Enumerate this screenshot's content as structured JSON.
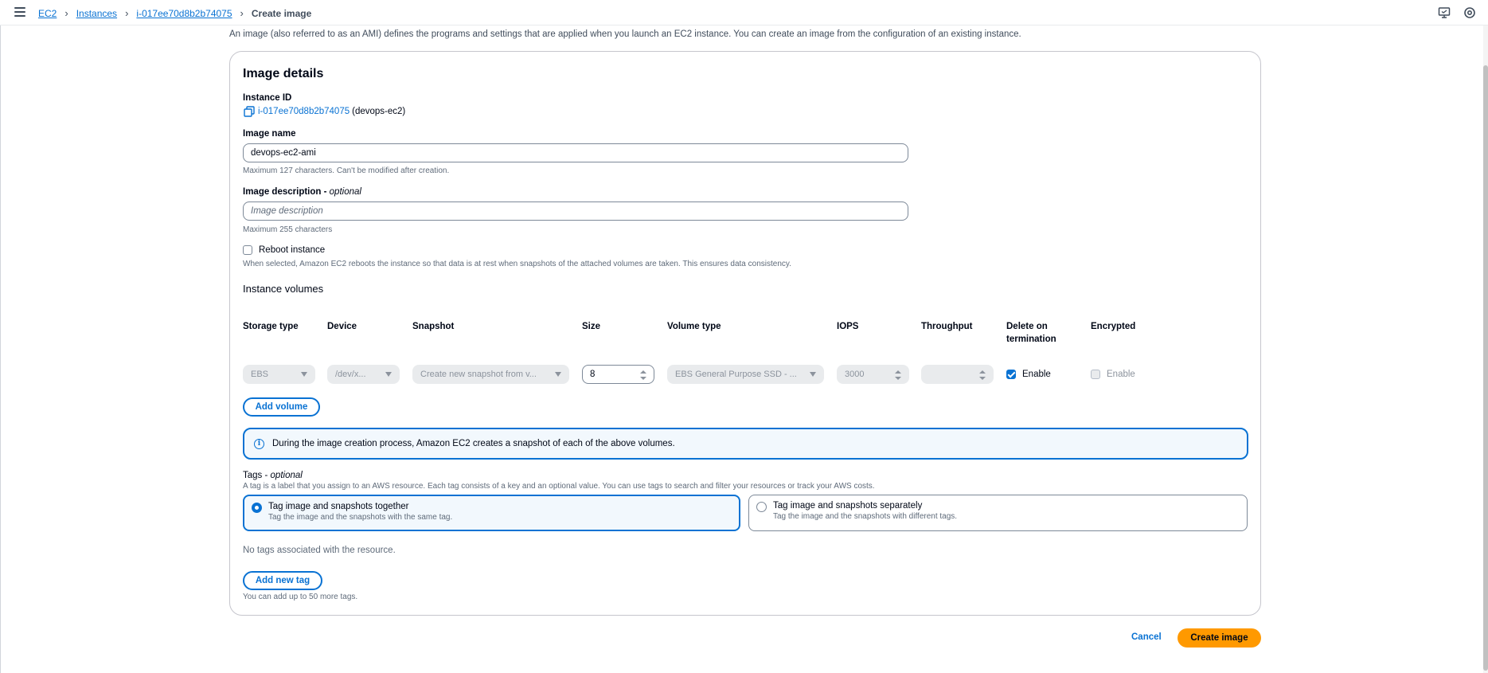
{
  "breadcrumbs": {
    "ec2": "EC2",
    "instances": "Instances",
    "instance_id": "i-017ee70d8b2b74075",
    "current": "Create image",
    "separator": ">"
  },
  "icons": {
    "menu": "hamburger-menu-icon",
    "notifications": "notifications-icon",
    "settings": "settings-icon",
    "copy": "copy-icon",
    "info": "info-icon"
  },
  "intro": "An image (also referred to as an AMI) defines the programs and settings that are applied when you launch an EC2 instance. You can create an image from the configuration of an existing instance.",
  "details": {
    "title": "Image details",
    "instance_id_label": "Instance ID",
    "instance_id_value": "i-017ee70d8b2b74075",
    "instance_name": "(devops-ec2)",
    "image_name_label": "Image name",
    "image_name_value": "devops-ec2-ami",
    "image_name_hint": "Maximum 127 characters. Can't be modified after creation.",
    "description_label": "Image description",
    "description_optional": "optional",
    "description_placeholder": "Image description",
    "description_hint": "Maximum 255 characters",
    "reboot_label": "Reboot instance",
    "reboot_checked": false,
    "reboot_hint": "When selected, Amazon EC2 reboots the instance so that data is at rest when snapshots of the attached volumes are taken. This ensures data consistency."
  },
  "volumes": {
    "title": "Instance volumes",
    "headers": {
      "storage_type": "Storage type",
      "device": "Device",
      "snapshot": "Snapshot",
      "size": "Size",
      "volume_type": "Volume type",
      "iops": "IOPS",
      "throughput": "Throughput",
      "delete_line1": "Delete on",
      "delete_line2": "termination",
      "encrypted": "Encrypted"
    },
    "row": {
      "storage_type": "EBS",
      "device": "/dev/x...",
      "snapshot": "Create new snapshot from v...",
      "size": "8",
      "volume_type": "EBS General Purpose SSD - ...",
      "iops": "3000",
      "throughput": "",
      "delete_on_termination": "Enable",
      "delete_checked": true,
      "encrypted": "Enable",
      "encrypted_checked": false
    },
    "add_volume": "Add volume",
    "info": "During the image creation process, Amazon EC2 creates a snapshot of each of the above volumes."
  },
  "tags": {
    "label": "Tags",
    "optional": "optional",
    "description": "A tag is a label that you assign to an AWS resource. Each tag consists of a key and an optional value. You can use tags to search and filter your resources or track your AWS costs.",
    "option_together_title": "Tag image and snapshots together",
    "option_together_desc": "Tag the image and the snapshots with the same tag.",
    "option_separate_title": "Tag image and snapshots separately",
    "option_separate_desc": "Tag the image and the snapshots with different tags.",
    "selected": "together",
    "empty": "No tags associated with the resource.",
    "add_tag": "Add new tag",
    "limit_hint": "You can add up to 50 more tags."
  },
  "footer": {
    "cancel": "Cancel",
    "create": "Create image"
  },
  "colors": {
    "link": "#0972d3",
    "primary": "#ff9900",
    "info_bg": "#f2f8fd"
  }
}
